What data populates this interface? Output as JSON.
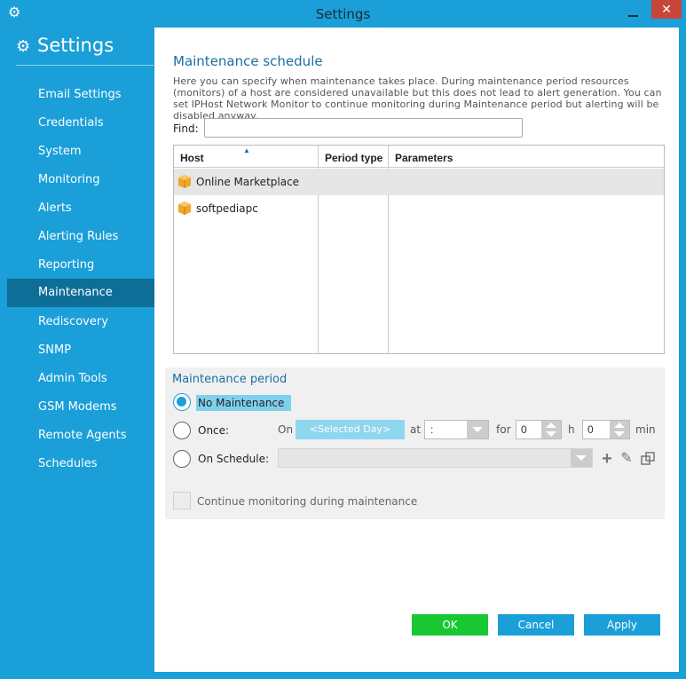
{
  "window": {
    "title": "Settings",
    "close_glyph": "✕"
  },
  "sidebar": {
    "header": "Settings",
    "items": [
      {
        "label": "Email Settings"
      },
      {
        "label": "Credentials"
      },
      {
        "label": "System"
      },
      {
        "label": "Monitoring"
      },
      {
        "label": "Alerts"
      },
      {
        "label": "Alerting Rules"
      },
      {
        "label": "Reporting"
      },
      {
        "label": "Maintenance",
        "active": true
      },
      {
        "label": "Rediscovery"
      },
      {
        "label": "SNMP"
      },
      {
        "label": "Admin Tools"
      },
      {
        "label": "GSM Modems"
      },
      {
        "label": "Remote Agents"
      },
      {
        "label": "Schedules"
      }
    ]
  },
  "main": {
    "title": "Maintenance schedule",
    "description": "Here you can specify when maintenance takes place. During maintenance period resources (monitors) of a host are considered unavailable but this does not lead to alert generation. You can set IPHost Network Monitor to continue monitoring during Maintenance period but alerting will be disabled anyway.",
    "find_label": "Find:",
    "find_value": "",
    "table": {
      "columns": [
        "Host",
        "Period type",
        "Parameters"
      ],
      "rows": [
        {
          "host": "Online Marketplace",
          "period_type": "",
          "parameters": ""
        },
        {
          "host": "softpediapc",
          "period_type": "",
          "parameters": ""
        }
      ]
    },
    "maintenance_period": {
      "title": "Maintenance period",
      "options": {
        "none": "No Maintenance",
        "once": "Once:",
        "schedule": "On Schedule:"
      },
      "selected": "none",
      "once": {
        "on_label": "On",
        "day_button": "<Selected Day>",
        "at_label": "at",
        "at_value": ":",
        "for_label": "for",
        "hours_value": "0",
        "h_label": "h",
        "minutes_value": "0",
        "min_label": "min"
      },
      "schedule_value": "",
      "continue_label": "Continue monitoring during maintenance",
      "continue_checked": false
    }
  },
  "buttons": {
    "ok": "OK",
    "cancel": "Cancel",
    "apply": "Apply"
  },
  "colors": {
    "accent": "#1a9fd8",
    "nav_active": "#0f6e98",
    "ok_green": "#18c832",
    "title_blue": "#1a6fa3"
  },
  "icons": [
    "gear-icon",
    "minimize-icon",
    "close-icon",
    "sort-up-icon",
    "host-box-icon",
    "add-icon",
    "edit-icon",
    "copy-icon"
  ]
}
